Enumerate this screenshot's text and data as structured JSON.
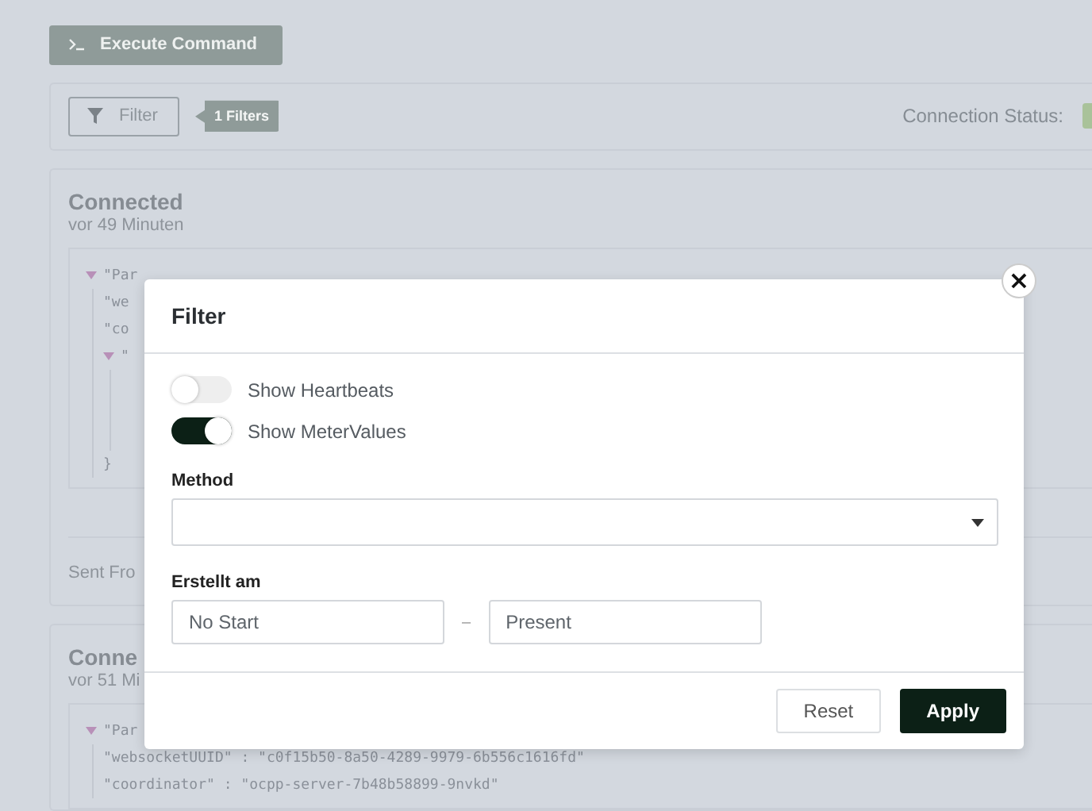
{
  "execute_button": {
    "label": "Execute Command"
  },
  "toolbar": {
    "filter_button": "Filter",
    "filter_badge": "1 Filters",
    "connection_status_label": "Connection Status:"
  },
  "events": [
    {
      "title": "Connected",
      "time": "vor 49 Minuten",
      "json": [
        {
          "text": "\"Par",
          "expanded": true,
          "children": [
            {
              "text": "\"we"
            },
            {
              "text": "\"co"
            },
            {
              "text": "\"",
              "expanded": true,
              "closing": "}"
            }
          ]
        }
      ],
      "footer": "Sent Fro"
    },
    {
      "title": "Conne",
      "time": "vor 51 Mi",
      "json": [
        {
          "text": "\"Par",
          "expanded": true,
          "children": [
            {
              "text": "\"websocketUUID\" : \"c0f15b50-8a50-4289-9979-6b556c1616fd\""
            },
            {
              "text": "\"coordinator\" : \"ocpp-server-7b48b58899-9nvkd\""
            }
          ]
        }
      ]
    }
  ],
  "dialog": {
    "title": "Filter",
    "close": "×",
    "toggles": [
      {
        "label": "Show Heartbeats",
        "on": false
      },
      {
        "label": "Show MeterValues",
        "on": true
      }
    ],
    "method": {
      "label": "Method"
    },
    "created": {
      "label": "Erstellt am",
      "start_placeholder": "No Start",
      "separator": "–",
      "end_placeholder": "Present"
    },
    "buttons": [
      {
        "label": "Reset",
        "kind": "secondary"
      },
      {
        "label": "Apply",
        "kind": "primary"
      }
    ]
  }
}
